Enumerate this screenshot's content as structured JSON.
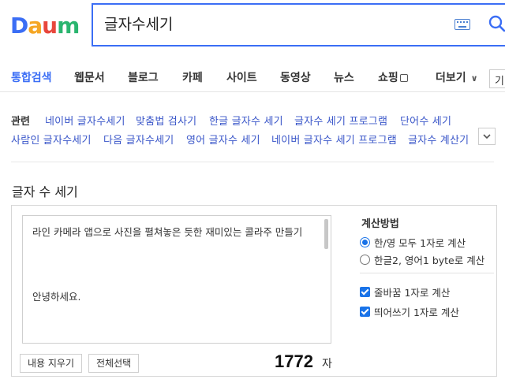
{
  "logo": {
    "letters": [
      "D",
      "a",
      "u",
      "m"
    ],
    "colors": [
      "#3b6ef5",
      "#f5a623",
      "#e8463c",
      "#2ab56f"
    ]
  },
  "search": {
    "query": "글자수세기"
  },
  "tabs": [
    {
      "label": "통합검색",
      "active": true
    },
    {
      "label": "웹문서"
    },
    {
      "label": "블로그"
    },
    {
      "label": "카페"
    },
    {
      "label": "사이트"
    },
    {
      "label": "동영상"
    },
    {
      "label": "뉴스"
    },
    {
      "label": "쇼핑"
    },
    {
      "label": "더보기"
    }
  ],
  "tab_cut_label": "기",
  "related": {
    "label": "관련",
    "items": [
      "네이버 글자수세기",
      "맞춤법 검사기",
      "한글 글자수 세기",
      "글자수 세기 프로그램",
      "단어수 세기",
      "사람인 글자수세기",
      "다음 글자수세기",
      "영어 글자수 세기",
      "네이버 글자수 세기 프로그램",
      "글자수 계산기"
    ]
  },
  "counter": {
    "title": "글자 수 세기",
    "text_line1": "라인 카메라 앱으로 사진을 펼쳐놓은 듯한 재미있는 콜라주 만들기",
    "text_line2": "안녕하세요.",
    "clear_button": "내용 지우기",
    "select_all_button": "전체선택",
    "count": "1772",
    "count_unit": "자",
    "method_title": "계산방법",
    "radio1": "한/영 모두 1자로 계산",
    "radio2": "한글2, 영어1 byte로 계산",
    "check1": "줄바꿈 1자로 계산",
    "check2": "띄어쓰기 1자로 계산"
  }
}
